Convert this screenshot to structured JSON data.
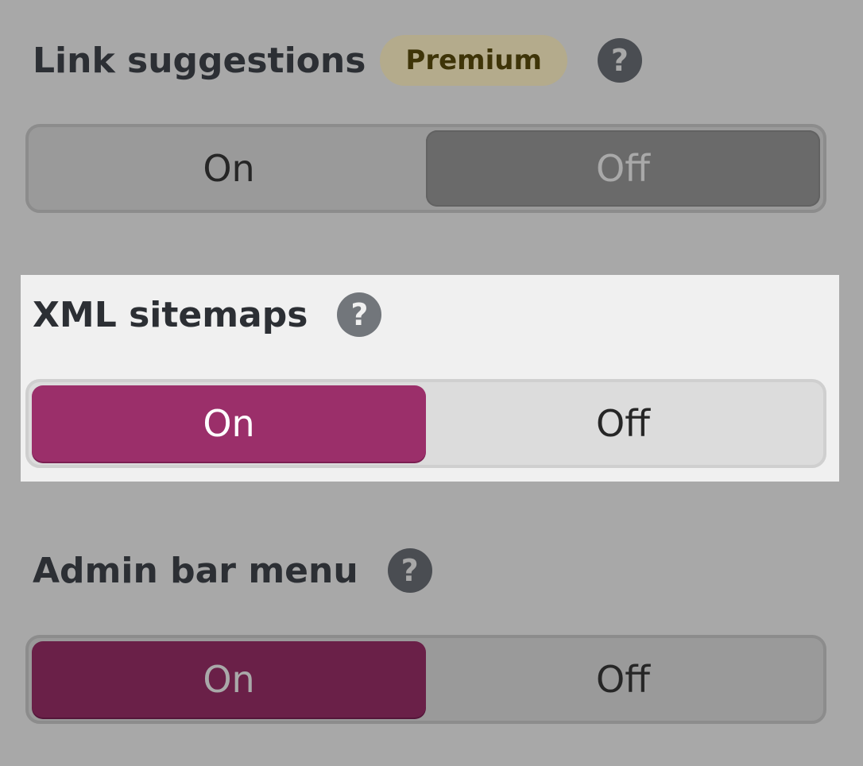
{
  "settings": [
    {
      "title": "Link suggestions",
      "badge": "Premium",
      "help_icon": "question-circle-icon",
      "options": {
        "on": "On",
        "off": "Off"
      },
      "selected": "Off"
    },
    {
      "title": "XML sitemaps",
      "help_icon": "question-circle-icon",
      "options": {
        "on": "On",
        "off": "Off"
      },
      "selected": "On",
      "highlighted": true
    },
    {
      "title": "Admin bar menu",
      "help_icon": "question-circle-icon",
      "options": {
        "on": "On",
        "off": "Off"
      },
      "selected": "On"
    }
  ],
  "help_glyph": "?",
  "colors": {
    "overlay": "#a8a8a8",
    "highlight_panel": "#f0f0f0",
    "accent": "#9b2f6a",
    "premium_badge": "#b4ab8c"
  }
}
